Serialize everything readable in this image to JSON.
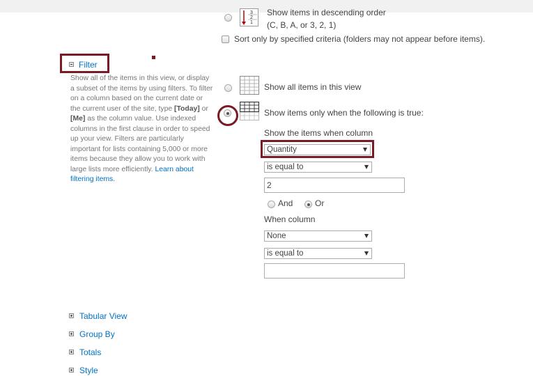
{
  "sort": {
    "descending_label": "Show items in descending order",
    "descending_example": "(C, B, A, or 3, 2, 1)",
    "sort_only_label": "Sort only by specified criteria (folders may not appear before items)."
  },
  "filter": {
    "title": "Filter",
    "description": {
      "p1": "Show all of the items in this view, or display a subset of the items by using filters. To filter on a column based on the current date or the current user of the site, type ",
      "today": "[Today]",
      "p2": " or ",
      "me": "[Me]",
      "p3": " as the column value. Use indexed columns in the first clause in order to speed up your view. Filters are particularly important for lists containing 5,000 or more items because they allow you to work with large lists more efficiently.",
      "link": "Learn about filtering items."
    },
    "show_all_label": "Show all items in this view",
    "show_when_label": "Show items only when the following is true:",
    "selected_option": "show_when",
    "show_items_when_column_label": "Show the items when column",
    "column1": "Quantity",
    "operator1": "is equal to",
    "value1": "2",
    "and_label": "And",
    "or_label": "Or",
    "logic_selected": "Or",
    "when_column_label": "When column",
    "column2": "None",
    "operator2": "is equal to",
    "value2": ""
  },
  "sections": {
    "tabular_view": "Tabular View",
    "group_by": "Group By",
    "totals": "Totals",
    "style": "Style"
  },
  "annotation_color": "#7b1a26",
  "link_color": "#0072c6"
}
